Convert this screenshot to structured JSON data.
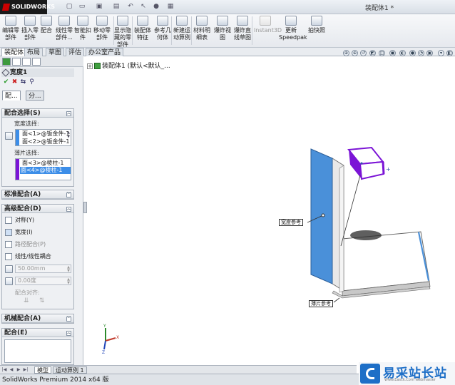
{
  "app": {
    "brand": "SOLIDWORKS",
    "doc_title": "装配体1 *"
  },
  "ribbon": {
    "buttons": [
      {
        "label": "编辑零部件"
      },
      {
        "label": "插入零部件"
      },
      {
        "label": "配合"
      },
      {
        "label": "线性零部件..."
      },
      {
        "label": "智能扣件"
      },
      {
        "label": "移动零部件"
      },
      {
        "label": "显示隐藏的零部件"
      },
      {
        "label": "装配体特征"
      },
      {
        "label": "参考几何体"
      },
      {
        "label": "新建运动算例"
      },
      {
        "label": "材料明细表"
      },
      {
        "label": "爆炸视图"
      },
      {
        "label": "爆炸直线草图"
      },
      {
        "label": "Instant3D"
      },
      {
        "label": "更新Speedpak"
      },
      {
        "label": "拍快照"
      }
    ]
  },
  "tabs": [
    "装配体",
    "布局",
    "草图",
    "评估",
    "办公室产品"
  ],
  "active_tab": "装配体",
  "tree": {
    "root": "装配体1 (默认<默认_..."
  },
  "property_manager": {
    "title": "宽度1",
    "subtabs": [
      "配...",
      "分..."
    ],
    "mate_selections": {
      "header": "配合选择(S)",
      "width_label": "宽度选择:",
      "width_items": [
        "面<1>@钣金件-1",
        "面<2>@钣金件-1"
      ],
      "tab_label": "薄片选择:",
      "tab_items": [
        "面<3>@棱柱-1",
        "面<4>@棱柱-1"
      ]
    },
    "standard_mates": {
      "header": "标准配合(A)"
    },
    "advanced_mates": {
      "header": "高级配合(D)",
      "options": [
        "对称(Y)",
        "宽度(I)",
        "路径配合(P)",
        "线性/线性耦合"
      ],
      "distance_value": "50.00mm",
      "angle_value": "0.00度",
      "alignment_label": "配合对齐:"
    },
    "mechanical_mates": {
      "header": "机械配合(A)"
    },
    "mates": {
      "header": "配合(E)"
    }
  },
  "viewport": {
    "callout_width_ref": "宽度参考",
    "callout_tab_ref": "薄片参考"
  },
  "bottom_tabs": [
    "模型",
    "运动算例 1"
  ],
  "status_bar": "SolidWorks Premium 2014 x64 版",
  "watermark": {
    "cn": "易采站长站",
    "en": "Www.Easck.Com Webmaster"
  },
  "colors": {
    "accent_blue": "#3d8ee8",
    "selection_purple": "#7b14d6",
    "face_blue": "#4a90d9"
  }
}
